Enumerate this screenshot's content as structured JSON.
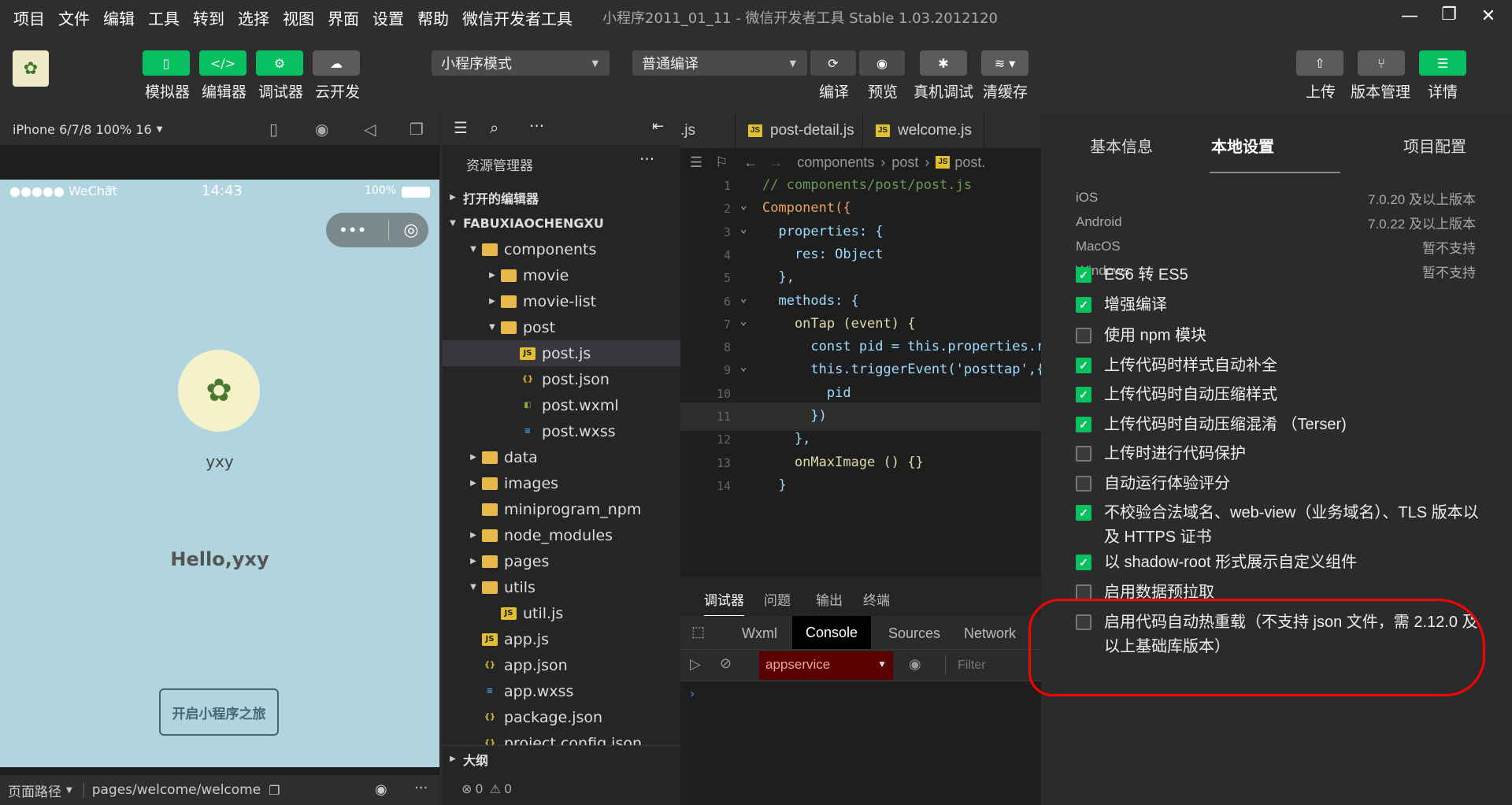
{
  "menu": {
    "items": [
      "项目",
      "文件",
      "编辑",
      "工具",
      "转到",
      "选择",
      "视图",
      "界面",
      "设置",
      "帮助",
      "微信开发者工具"
    ],
    "window_title": "小程序2011_01_11 - 微信开发者工具 Stable 1.03.2012120"
  },
  "toolbar": {
    "simulator": "模拟器",
    "editor": "编辑器",
    "debugger": "调试器",
    "cloud": "云开发",
    "mode_select": "小程序模式",
    "compile_select": "普通编译",
    "compile": "编译",
    "preview": "预览",
    "real_debug": "真机调试",
    "clear_cache": "清缓存",
    "upload": "上传",
    "version": "版本管理",
    "details": "详情"
  },
  "simulator": {
    "device": "iPhone 6/7/8 100% 16",
    "carrier": "●●●●● WeChat",
    "time": "14:43",
    "battery": "100%",
    "username": "yxy",
    "greeting": "Hello,yxy",
    "start_button": "开启小程序之旅",
    "path_label": "页面路径",
    "path_value": "pages/welcome/welcome"
  },
  "explorer": {
    "title": "资源管理器",
    "open_editors": "打开的编辑器",
    "project": "FABUXIAOCHENGXU",
    "outline": "大纲",
    "status_errors": "0",
    "status_warnings": "0",
    "tree": [
      {
        "name": "components",
        "type": "folder",
        "open": true
      },
      {
        "name": "movie",
        "type": "folder"
      },
      {
        "name": "movie-list",
        "type": "folder"
      },
      {
        "name": "post",
        "type": "folder",
        "open": true
      },
      {
        "name": "post.js",
        "type": "js"
      },
      {
        "name": "post.json",
        "type": "json"
      },
      {
        "name": "post.wxml",
        "type": "wxml"
      },
      {
        "name": "post.wxss",
        "type": "wxss"
      },
      {
        "name": "data",
        "type": "folder"
      },
      {
        "name": "images",
        "type": "folder"
      },
      {
        "name": "miniprogram_npm",
        "type": "folder"
      },
      {
        "name": "node_modules",
        "type": "folder"
      },
      {
        "name": "pages",
        "type": "folder"
      },
      {
        "name": "utils",
        "type": "folder",
        "open": true
      },
      {
        "name": "util.js",
        "type": "js"
      },
      {
        "name": "app.js",
        "type": "js"
      },
      {
        "name": "app.json",
        "type": "json"
      },
      {
        "name": "app.wxss",
        "type": "wxss"
      },
      {
        "name": "package.json",
        "type": "json"
      },
      {
        "name": "project.config.json",
        "type": "json"
      }
    ]
  },
  "editor": {
    "tabs": [
      ".js",
      "post-detail.js",
      "welcome.js"
    ],
    "breadcrumb": [
      "components",
      "post",
      "post."
    ],
    "lines": [
      {
        "n": "1",
        "text": "// components/post/post.js"
      },
      {
        "n": "2",
        "text": "Component({"
      },
      {
        "n": "3",
        "text": "  properties: {"
      },
      {
        "n": "4",
        "text": "    res: Object"
      },
      {
        "n": "5",
        "text": "  },"
      },
      {
        "n": "6",
        "text": "  methods: {"
      },
      {
        "n": "7",
        "text": "    onTap (event) {"
      },
      {
        "n": "8",
        "text": "      const pid = this.properties.re"
      },
      {
        "n": "9",
        "text": "      this.triggerEvent('posttap',{"
      },
      {
        "n": "10",
        "text": "        pid"
      },
      {
        "n": "11",
        "text": "      })"
      },
      {
        "n": "12",
        "text": "    },"
      },
      {
        "n": "13",
        "text": "    onMaxImage () {}"
      },
      {
        "n": "14",
        "text": "  }"
      }
    ]
  },
  "debugger": {
    "tabs": [
      "调试器",
      "问题",
      "输出",
      "终端"
    ],
    "subtabs": [
      "Wxml",
      "Console",
      "Sources",
      "Network"
    ],
    "context": "appservice",
    "filter_placeholder": "Filter"
  },
  "details": {
    "tabs": [
      "基本信息",
      "本地设置",
      "项目配置"
    ],
    "platforms": [
      {
        "k": "iOS",
        "v": "7.0.20 及以上版本"
      },
      {
        "k": "Android",
        "v": "7.0.22 及以上版本"
      },
      {
        "k": "MacOS",
        "v": "暂不支持"
      },
      {
        "k": "Windows",
        "v": "暂不支持"
      }
    ],
    "options": [
      {
        "label": "ES6 转 ES5",
        "checked": true
      },
      {
        "label": "增强编译",
        "checked": true
      },
      {
        "label": "使用 npm 模块",
        "checked": false
      },
      {
        "label": "上传代码时样式自动补全",
        "checked": true
      },
      {
        "label": "上传代码时自动压缩样式",
        "checked": true
      },
      {
        "label": "上传代码时自动压缩混淆 （Terser)",
        "checked": true
      },
      {
        "label": "上传时进行代码保护",
        "checked": false
      },
      {
        "label": "自动运行体验评分",
        "checked": false
      },
      {
        "label": "不校验合法域名、web-view（业务域名）、TLS 版本以及 HTTPS 证书",
        "checked": true
      },
      {
        "label": "以 shadow-root 形式展示自定义组件",
        "checked": true
      },
      {
        "label": "启用数据预拉取",
        "checked": false
      },
      {
        "label": "启用代码自动热重载（不支持 json 文件，需 2.12.0 及以上基础库版本）",
        "checked": false
      }
    ]
  },
  "colors": {
    "accent": "#07c160",
    "annotation": "#ff0000",
    "sim_bg": "#b0d5df"
  }
}
